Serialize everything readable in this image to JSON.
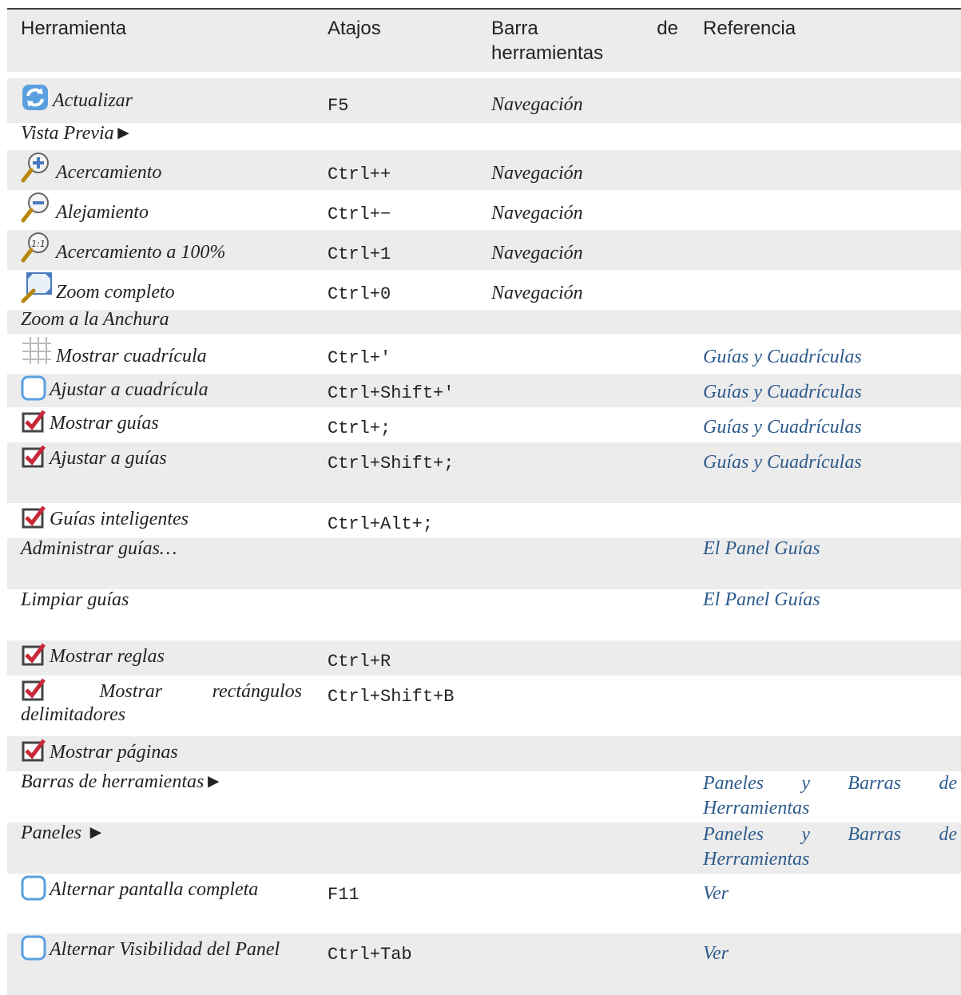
{
  "headers": {
    "tool": "Herramienta",
    "shortcut": "Atajos",
    "toolbar_word1": "Barra",
    "toolbar_word2": "de",
    "toolbar_line2": "herramientas",
    "reference": "Referencia"
  },
  "rows": {
    "refresh": {
      "tool": "Actualizar",
      "shortcut": "F5",
      "toolbar": "Navegación",
      "icon": "refresh-icon"
    },
    "preview": {
      "tool": "Vista Previa►"
    },
    "zoom_in": {
      "tool": "Acercamiento",
      "shortcut": "Ctrl++",
      "toolbar": "Navegación",
      "icon": "zoom-in-icon"
    },
    "zoom_out": {
      "tool": "Alejamiento",
      "shortcut": "Ctrl+−",
      "toolbar": "Navegación",
      "icon": "zoom-out-icon"
    },
    "zoom_100": {
      "tool": "Acercamiento a 100%",
      "shortcut": "Ctrl+1",
      "toolbar": "Navegación",
      "icon": "zoom-100-icon"
    },
    "zoom_fit": {
      "tool": "Zoom completo",
      "shortcut": "Ctrl+0",
      "toolbar": "Navegación",
      "icon": "zoom-fit-icon"
    },
    "zoom_width": {
      "tool": "Zoom a la Anchura"
    },
    "show_grid": {
      "tool": "Mostrar cuadrícula",
      "shortcut": "Ctrl+'",
      "reference": "Guías y Cuadrículas",
      "icon": "grid-icon"
    },
    "snap_grid": {
      "tool": "Ajustar a cuadrícula",
      "shortcut": "Ctrl+Shift+'",
      "reference": "Guías y Cuadrículas",
      "icon": "checkbox-unchecked-icon"
    },
    "show_guides": {
      "tool": "Mostrar guías",
      "shortcut": "Ctrl+;",
      "reference": "Guías y Cuadrículas",
      "icon": "checkbox-checked-icon"
    },
    "snap_guides": {
      "tool": "Ajustar a guías",
      "shortcut": "Ctrl+Shift+;",
      "reference": "Guías y Cuadrículas",
      "icon": "checkbox-checked-icon"
    },
    "smart_guides": {
      "tool": "Guías inteligentes",
      "shortcut": "Ctrl+Alt+;",
      "icon": "checkbox-checked-icon"
    },
    "manage_guides": {
      "tool": "Administrar guías…",
      "reference": "El Panel Guías"
    },
    "clear_guides": {
      "tool": "Limpiar guías",
      "reference": "El Panel Guías"
    },
    "show_rulers": {
      "tool": "Mostrar reglas",
      "shortcut": "Ctrl+R",
      "icon": "checkbox-checked-icon"
    },
    "show_bbox": {
      "tool_word1": "Mostrar",
      "tool_word2": "rectángulos",
      "tool_line2": "delimitadores",
      "shortcut": "Ctrl+Shift+B",
      "icon": "checkbox-checked-icon"
    },
    "show_pages": {
      "tool": "Mostrar páginas",
      "icon": "checkbox-checked-icon"
    },
    "toolbars": {
      "tool": "Barras de herramientas►",
      "ref_w1": "Paneles",
      "ref_w2": "y",
      "ref_w3": "Barras",
      "ref_w4": "de",
      "ref_line2": "Herramientas"
    },
    "panels": {
      "tool": "Paneles ►",
      "ref_w1": "Paneles",
      "ref_w2": "y",
      "ref_w3": "Barras",
      "ref_w4": "de",
      "ref_line2": "Herramientas"
    },
    "fullscreen": {
      "tool": "Alternar pantalla completa",
      "shortcut": "F11",
      "reference": "Ver",
      "icon": "checkbox-unchecked-icon"
    },
    "panel_visibility": {
      "tool": "Alternar Visibilidad del Panel",
      "shortcut": "Ctrl+Tab",
      "reference": "Ver",
      "icon": "checkbox-unchecked-icon"
    }
  }
}
